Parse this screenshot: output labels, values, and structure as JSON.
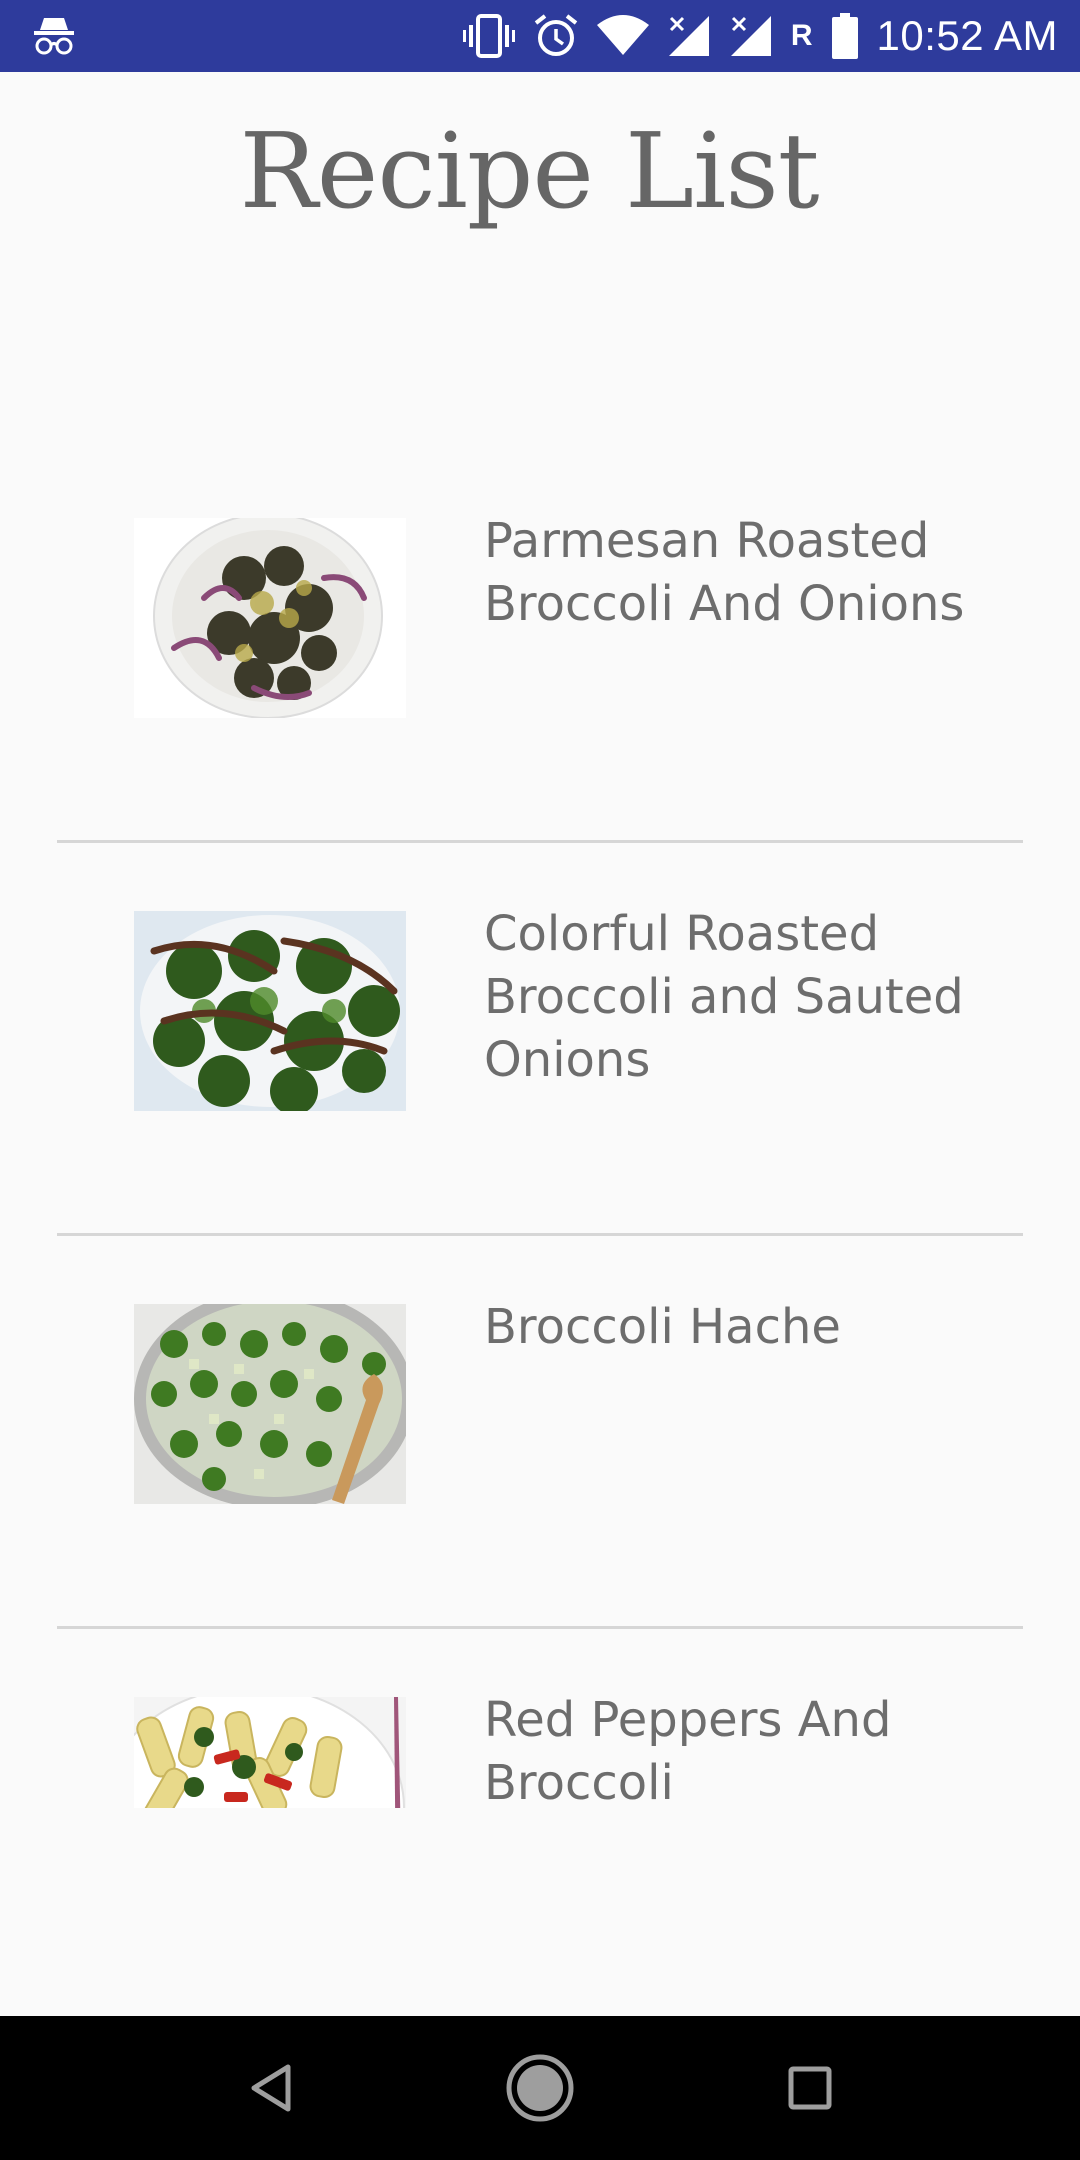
{
  "status_bar": {
    "time": "10:52 AM",
    "roaming_label": "R",
    "icons": [
      "incognito-icon",
      "vibrate-icon",
      "alarm-icon",
      "wifi-icon",
      "signal-icon",
      "signal-icon",
      "battery-icon"
    ],
    "background": "#2e3b9c"
  },
  "header": {
    "title": "Recipe List"
  },
  "recipes": [
    {
      "name": "Parmesan Roasted Broccoli And Onions"
    },
    {
      "name": "Colorful Roasted Broccoli and Sauted Onions"
    },
    {
      "name": "Broccoli Hache"
    },
    {
      "name": "Red Peppers And Broccoli"
    }
  ],
  "nav_bar": {
    "icons": [
      "back-icon",
      "home-icon",
      "recents-icon"
    ]
  }
}
